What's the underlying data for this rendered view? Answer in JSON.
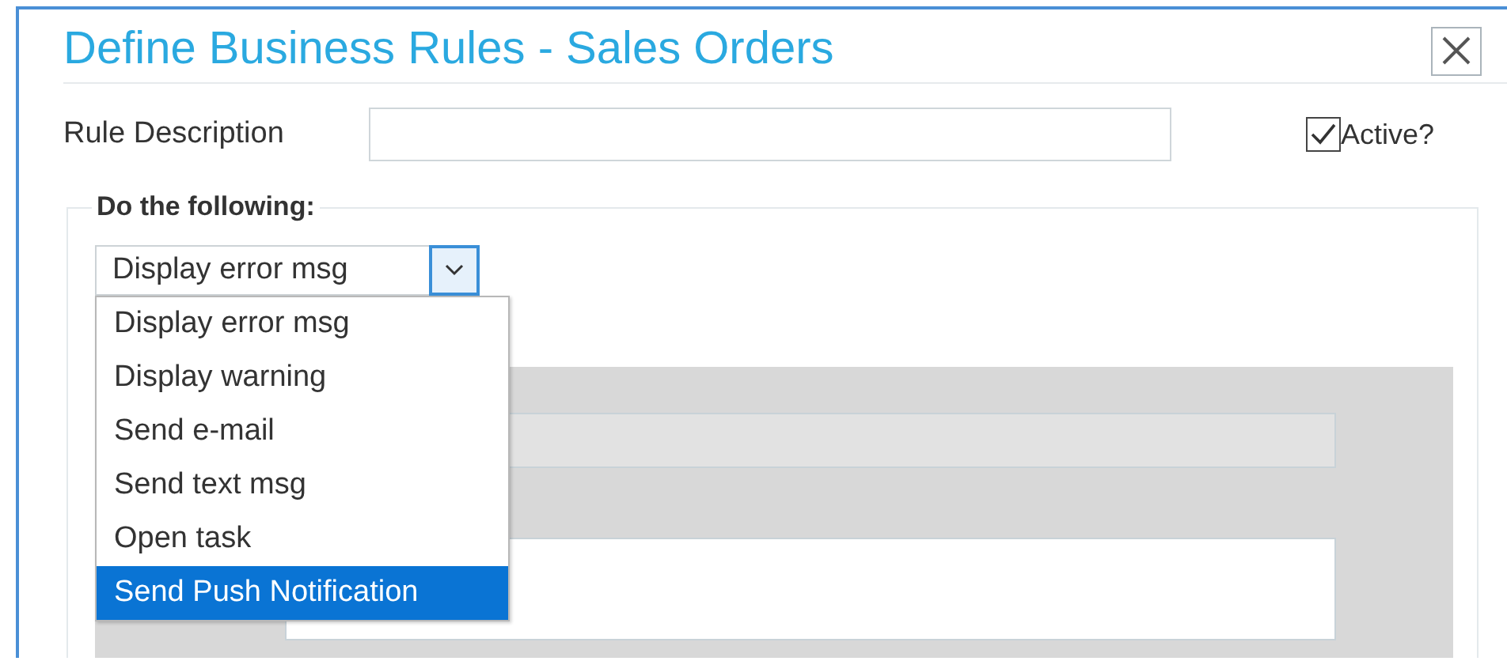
{
  "window": {
    "title": "Define Business Rules - Sales Orders"
  },
  "rule_description": {
    "label": "Rule Description"
  },
  "active": {
    "label": "Active?",
    "checked": true
  },
  "action": {
    "legend": "Do the following:",
    "select": {
      "value": "Display error msg",
      "expanded": true
    },
    "options": [
      {
        "label": "Display error msg",
        "selected": false
      },
      {
        "label": "Display warning",
        "selected": false
      },
      {
        "label": "Send e-mail",
        "selected": false
      },
      {
        "label": "Send text msg",
        "selected": false
      },
      {
        "label": "Open task",
        "selected": false
      },
      {
        "label": "Send Push Notification",
        "selected": true
      }
    ],
    "fields": [
      {
        "disabled": true
      },
      {
        "disabled": false
      }
    ]
  }
}
